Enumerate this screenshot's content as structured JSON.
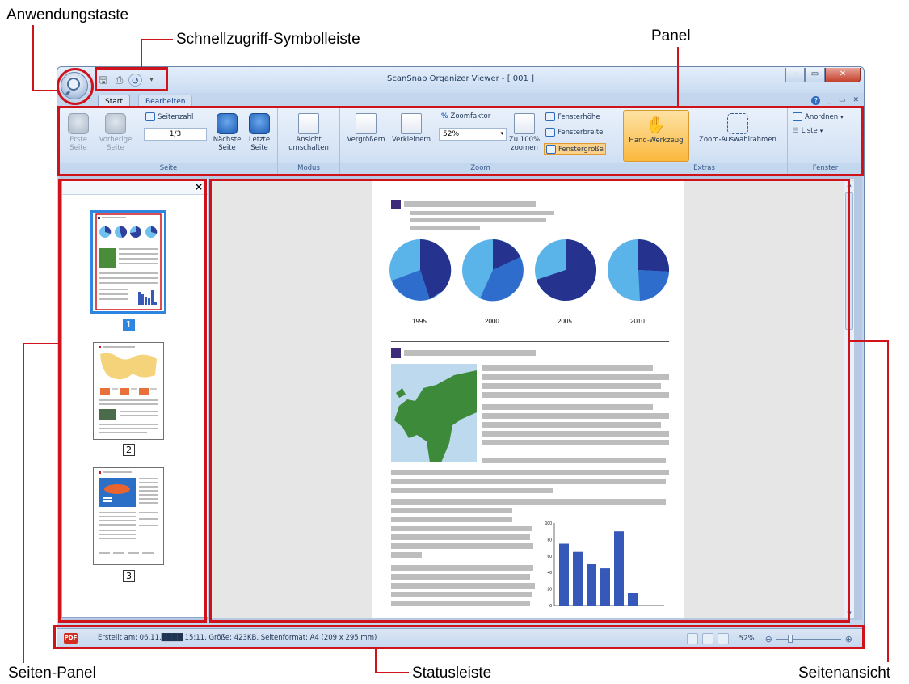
{
  "callouts": {
    "app_button": "Anwendungstaste",
    "qat": "Schnellzugriff-Symbolleiste",
    "panel": "Panel",
    "side_panel": "Seiten-Panel",
    "statusbar": "Statusleiste",
    "page_view": "Seitenansicht"
  },
  "window": {
    "title": "ScanSnap Organizer Viewer - [ 001 ]"
  },
  "tabs": [
    {
      "label": "Start"
    },
    {
      "label": "Bearbeiten"
    }
  ],
  "ribbon": {
    "seite": {
      "label": "Seite",
      "first": "Erste Seite",
      "prev": "Vorherige Seite",
      "page_count_label": "Seitenzahl",
      "page_value": "1/3",
      "next": "Nächste Seite",
      "last": "Letzte Seite"
    },
    "modus": {
      "label": "Modus",
      "switch_view": "Ansicht umschalten"
    },
    "zoom": {
      "label": "Zoom",
      "zoom_in": "Vergrößern",
      "zoom_out": "Verkleinern",
      "zoom_factor_label": "Zoomfaktor",
      "zoom_value": "52%",
      "zoom_100": "Zu 100% zoomen",
      "fit_height": "Fensterhöhe",
      "fit_width": "Fensterbreite",
      "fit_window": "Fenstergröße"
    },
    "extras": {
      "label": "Extras",
      "hand_tool": "Hand-Werkzeug",
      "zoom_frame": "Zoom-Auswahlrahmen"
    },
    "fenster": {
      "label": "Fenster",
      "arrange": "Anordnen",
      "list": "Liste"
    }
  },
  "pages": [
    {
      "number": "1"
    },
    {
      "number": "2"
    },
    {
      "number": "3"
    }
  ],
  "document": {
    "years": [
      "1995",
      "2000",
      "2005",
      "2010"
    ],
    "bar_axis_ticks": [
      "100",
      "80",
      "60",
      "40",
      "20",
      "0"
    ],
    "bar_values": [
      75,
      65,
      50,
      45,
      90,
      15
    ]
  },
  "statusbar": {
    "badge": "PDF",
    "info": "Erstellt am: 06.11.████ 15:11, Größe: 423KB, Seitenformat: A4 (209 x 295 mm)",
    "zoom": "52%"
  },
  "colors": {
    "callout_red": "#d0121b",
    "hand_tool_active": "#fbb93e",
    "ribbon_bg": "#d5e3f5"
  }
}
